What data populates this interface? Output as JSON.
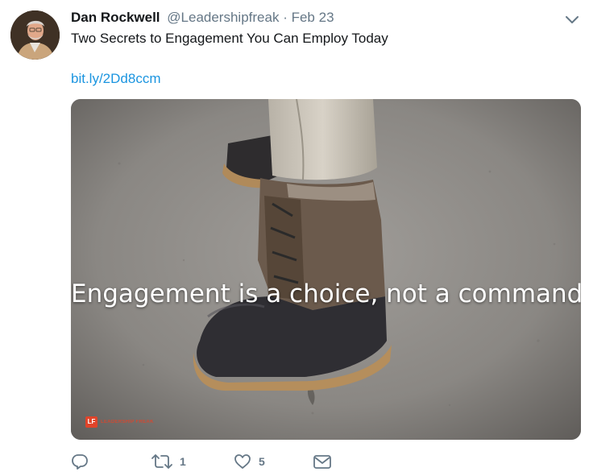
{
  "tweet": {
    "author_name": "Dan Rockwell",
    "handle": "@Leadershipfreak",
    "separator": "·",
    "time": "Feb 23",
    "text": "Two Secrets to Engagement You Can Employ Today",
    "link": "bit.ly/2Dd8ccm"
  },
  "media": {
    "caption": "Engagement is a choice, not a command.",
    "watermark_badge": "LF",
    "watermark_text": "LEADERSHIP FREAK"
  },
  "actions": {
    "reply_count": "",
    "retweet_count": "1",
    "like_count": "5"
  },
  "colors": {
    "link": "#1b95e0",
    "meta": "#657786",
    "text": "#14171a"
  },
  "icons": [
    "chevron-down-icon",
    "reply-icon",
    "retweet-icon",
    "heart-icon",
    "message-icon"
  ]
}
